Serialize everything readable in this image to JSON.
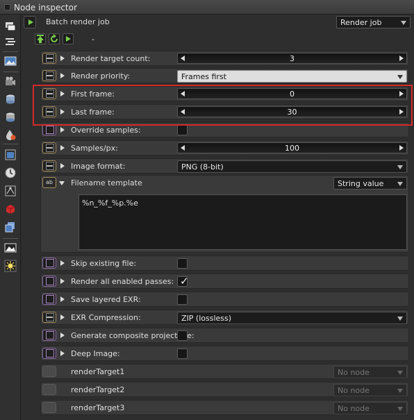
{
  "window": {
    "title": "Node inspector"
  },
  "header": {
    "node_name": "Batch render job",
    "node_type": "Render job",
    "dash": "-"
  },
  "toolbar": {
    "icons": [
      "layers-icon",
      "list-icon",
      "image-icon",
      "camera-icon",
      "database-icon",
      "database-alt-icon",
      "color-drop-icon",
      "render-window-icon",
      "clock-icon",
      "node-graph-icon",
      "red-cube-icon",
      "blue-cube-icon",
      "picture-icon",
      "sun-icon"
    ]
  },
  "actions": [
    "upload-icon",
    "refresh-icon",
    "play-icon"
  ],
  "rows": {
    "render_target_count": {
      "label": "Render target count:",
      "value": "3"
    },
    "render_priority": {
      "label": "Render priority:",
      "value": "Frames first"
    },
    "first_frame": {
      "label": "First frame:",
      "value": "0"
    },
    "last_frame": {
      "label": "Last frame:",
      "value": "30"
    },
    "override_samples": {
      "label": "Override samples:",
      "checked": false
    },
    "samples_px": {
      "label": "Samples/px:",
      "value": "100"
    },
    "image_format": {
      "label": "Image format:",
      "value": "PNG (8-bit)"
    },
    "filename_template": {
      "label": "Filename template",
      "mode": "String value",
      "value": "%n_%f_%p.%e",
      "pin": "ab"
    },
    "skip_existing": {
      "label": "Skip existing file:",
      "checked": false
    },
    "render_all_passes": {
      "label": "Render all enabled passes:",
      "checked": true,
      "mark": "✓"
    },
    "save_layered_exr": {
      "label": "Save layered EXR:",
      "checked": false
    },
    "exr_compression": {
      "label": "EXR Compression:",
      "value": "ZIP (lossless)"
    },
    "generate_composite": {
      "label": "Generate composite project file:",
      "checked": false
    },
    "deep_image": {
      "label": "Deep Image:",
      "checked": false
    },
    "render_target_1": {
      "label": "renderTarget1",
      "value": "No node"
    },
    "render_target_2": {
      "label": "renderTarget2",
      "value": "No node"
    },
    "render_target_3": {
      "label": "renderTarget3",
      "value": "No node"
    }
  },
  "colors": {
    "highlight": "#d42a2a",
    "play": "#7bd04e",
    "pin_value": "#a89060",
    "pin_toggle": "#9070a8"
  }
}
